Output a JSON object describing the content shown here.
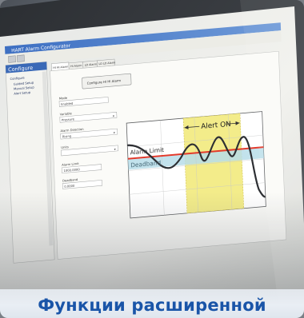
{
  "caption": "Функции расширенной",
  "screen": {
    "window_title": "HART Alarm Configurator",
    "sidebar_header": "Configure",
    "tree_items": [
      "Configure",
      "Guided Setup",
      "Manual Setup",
      "Alert Setup"
    ],
    "tabs": [
      "HI HI Alarm",
      "HI Alarm",
      "LO Alarm",
      "LO LO Alarm"
    ],
    "configure_button": "Configure HI HI Alarm",
    "fields": [
      {
        "label": "Mode",
        "value": "Enabled"
      },
      {
        "label": "Variable",
        "value": "Pressure"
      },
      {
        "label": "Alarm Direction",
        "value": "Rising"
      },
      {
        "label": "Units",
        "value": ""
      },
      {
        "label": "Alarm Limit",
        "value": "1000.0000"
      },
      {
        "label": "Deadband",
        "value": "0.0000"
      }
    ]
  },
  "diagram": {
    "alert_label": "Alert ON",
    "alarm_limit_label": "Alarm Limit",
    "deadband_label": "Deadband",
    "colors": {
      "alert_zone": "#f3ec8a",
      "deadband_band": "#b7dde9",
      "limit_line": "#e23a2c",
      "signal_line": "#2d2f33"
    }
  }
}
